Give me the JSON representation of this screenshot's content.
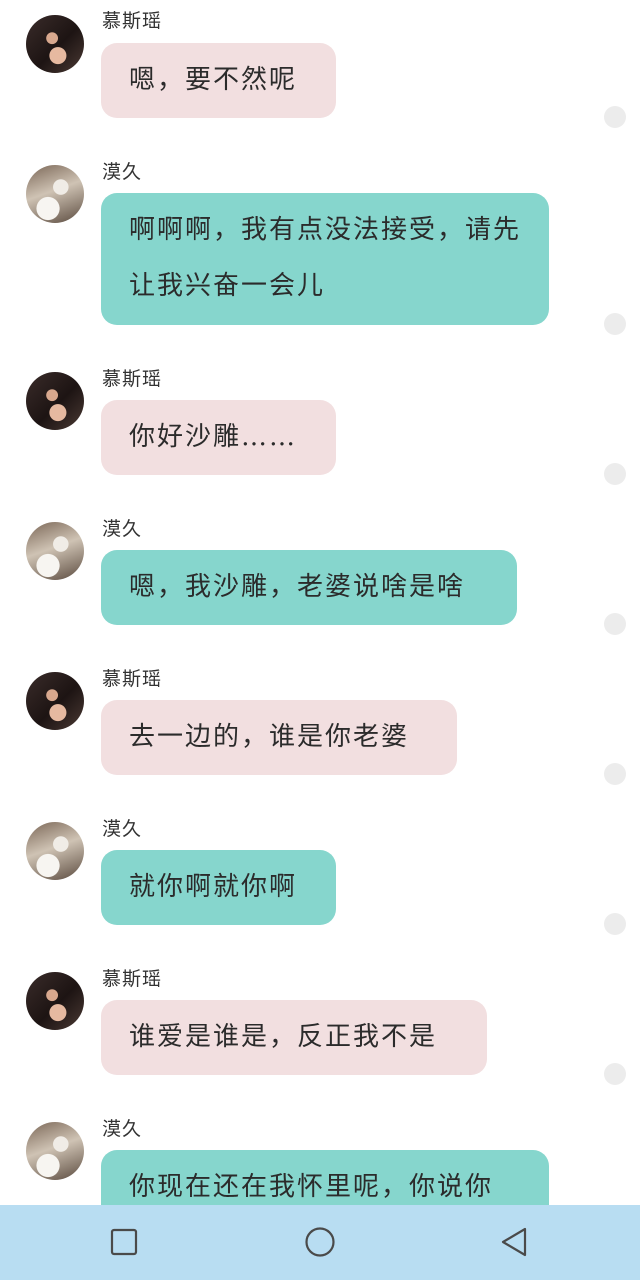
{
  "messages": [
    {
      "sender": "慕斯瑶",
      "side": "female",
      "text": "嗯，要不然呢"
    },
    {
      "sender": "漠久",
      "side": "male",
      "text": "啊啊啊，我有点没法接受，请先让我兴奋一会儿"
    },
    {
      "sender": "慕斯瑶",
      "side": "female",
      "text": "你好沙雕……"
    },
    {
      "sender": "漠久",
      "side": "male",
      "text": "嗯，我沙雕，老婆说啥是啥"
    },
    {
      "sender": "慕斯瑶",
      "side": "female",
      "text": "去一边的，谁是你老婆"
    },
    {
      "sender": "漠久",
      "side": "male",
      "text": "就你啊就你啊"
    },
    {
      "sender": "慕斯瑶",
      "side": "female",
      "text": "谁爱是谁是，反正我不是"
    },
    {
      "sender": "漠久",
      "side": "male",
      "text": "你现在还在我怀里呢，你说你"
    }
  ],
  "colors": {
    "female_bubble": "#f2dfe0",
    "male_bubble": "#86d6cd",
    "navbar": "#b8ddf2"
  },
  "navbar": {
    "buttons": [
      "recent-apps-icon",
      "home-icon",
      "back-icon"
    ]
  }
}
